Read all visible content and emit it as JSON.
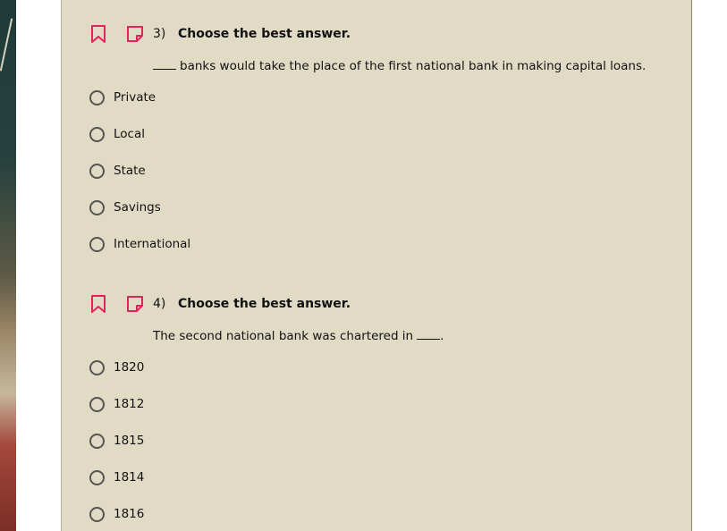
{
  "questions": [
    {
      "number": "3)",
      "title": "Choose the best answer.",
      "prompt": "banks would take the place of the first national bank in making capital loans.",
      "options": [
        "Private",
        "Local",
        "State",
        "Savings",
        "International"
      ]
    },
    {
      "number": "4)",
      "title": "Choose the best answer.",
      "prompt": "The second national bank was chartered in",
      "options": [
        "1820",
        "1812",
        "1815",
        "1814",
        "1816"
      ]
    }
  ],
  "colors": {
    "panel": "#e1dbc6",
    "accent": "#e0245e",
    "radio_border": "#555555"
  },
  "icons": {
    "bookmark": "bookmark-icon",
    "note": "note-icon"
  }
}
